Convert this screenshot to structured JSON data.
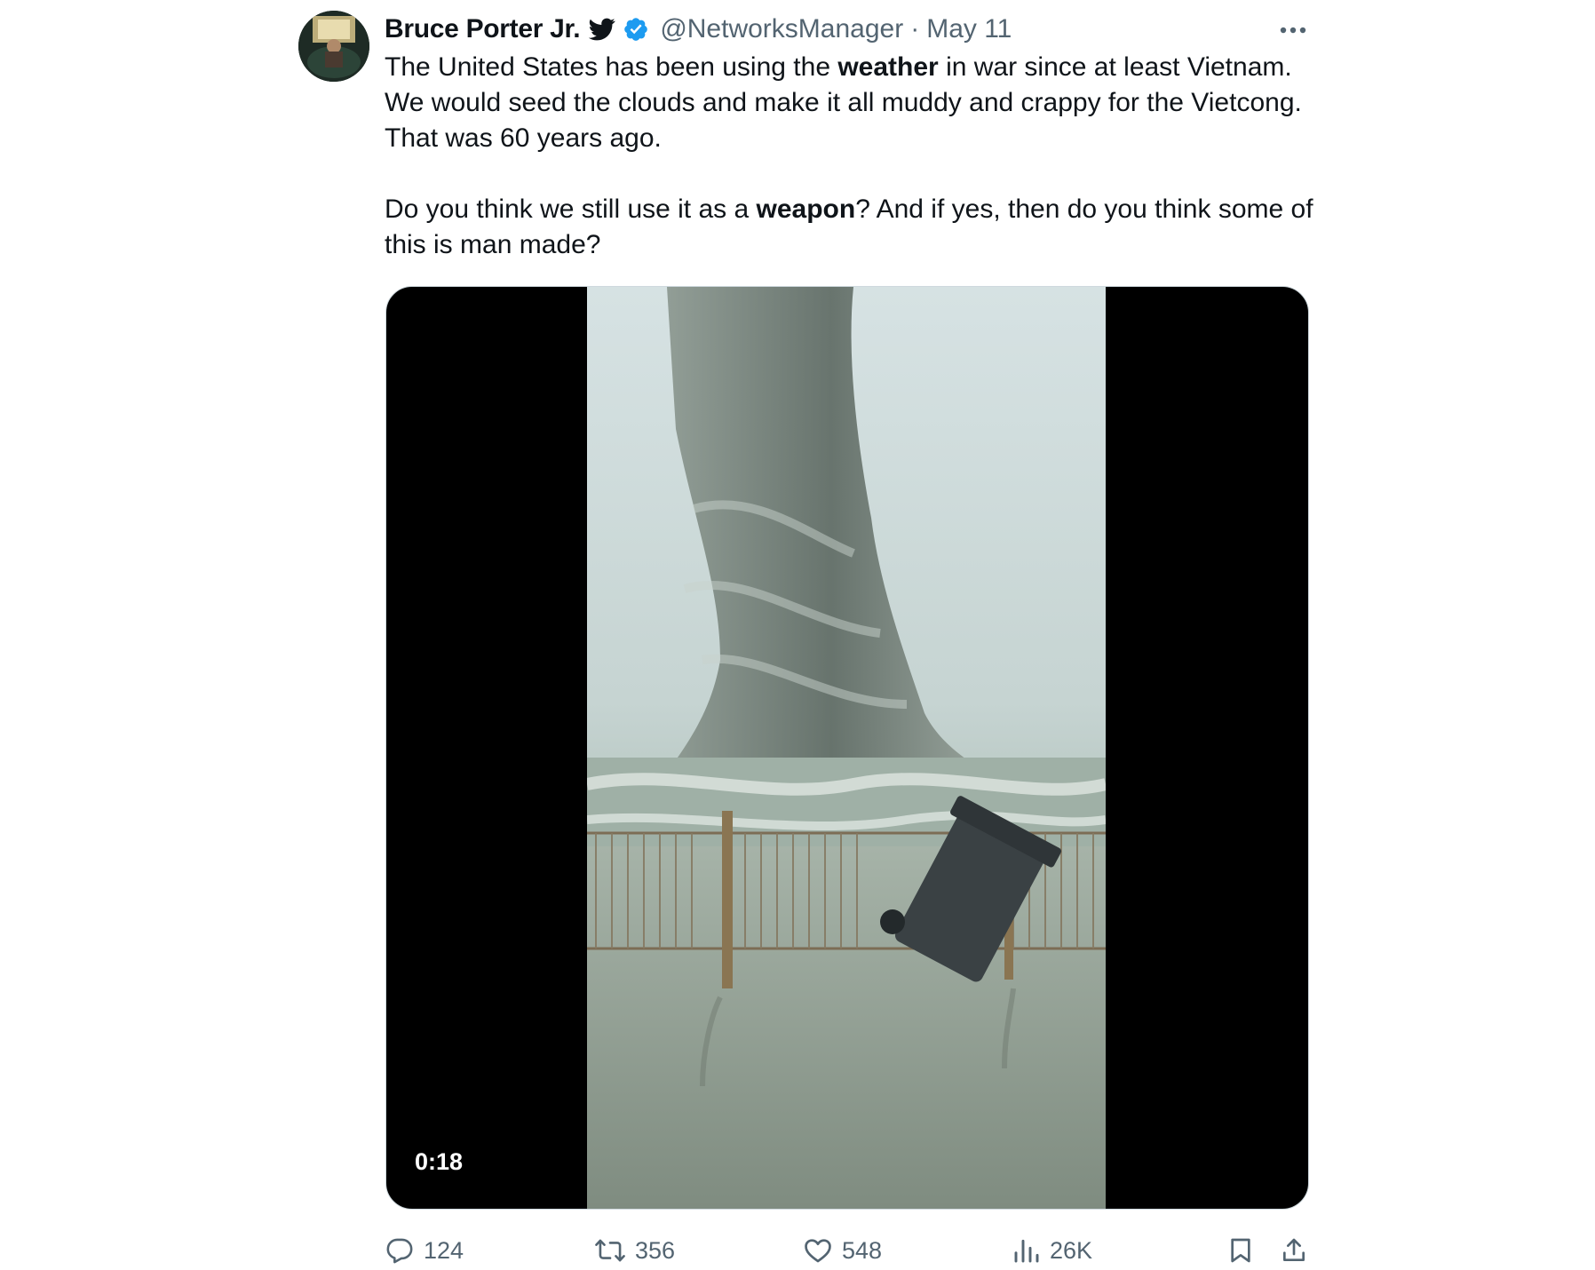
{
  "tweet": {
    "author": {
      "display_name": "Bruce Porter Jr.",
      "handle": "@NetworksManager",
      "avatar_icon": "user-avatar"
    },
    "separator": "·",
    "date": "May 11",
    "paragraphs": [
      [
        {
          "text": "The United States has been using the ",
          "bold": false
        },
        {
          "text": "weather",
          "bold": true
        },
        {
          "text": " in war since at least Vietnam. We would seed the clouds and make it all muddy and crappy for the Vietcong. That was 60 years ago.",
          "bold": false
        }
      ],
      [
        {
          "text": "Do you think we still use it as a ",
          "bold": false
        },
        {
          "text": "weapon",
          "bold": true
        },
        {
          "text": "? And if yes, then do you think some of this is man made?",
          "bold": false
        }
      ]
    ],
    "video": {
      "duration": "0:18"
    },
    "metrics": {
      "replies": "124",
      "retweets": "356",
      "likes": "548",
      "views": "26K"
    }
  },
  "colors": {
    "text_primary": "#0f1419",
    "text_secondary": "#536471",
    "verified_blue": "#1d9bf0"
  },
  "icons": {
    "bird": "bird-icon",
    "verified": "verified-badge-icon",
    "more": "more-icon",
    "reply": "reply-icon",
    "retweet": "retweet-icon",
    "like": "like-icon",
    "views": "views-icon",
    "bookmark": "bookmark-icon",
    "share": "share-icon"
  }
}
